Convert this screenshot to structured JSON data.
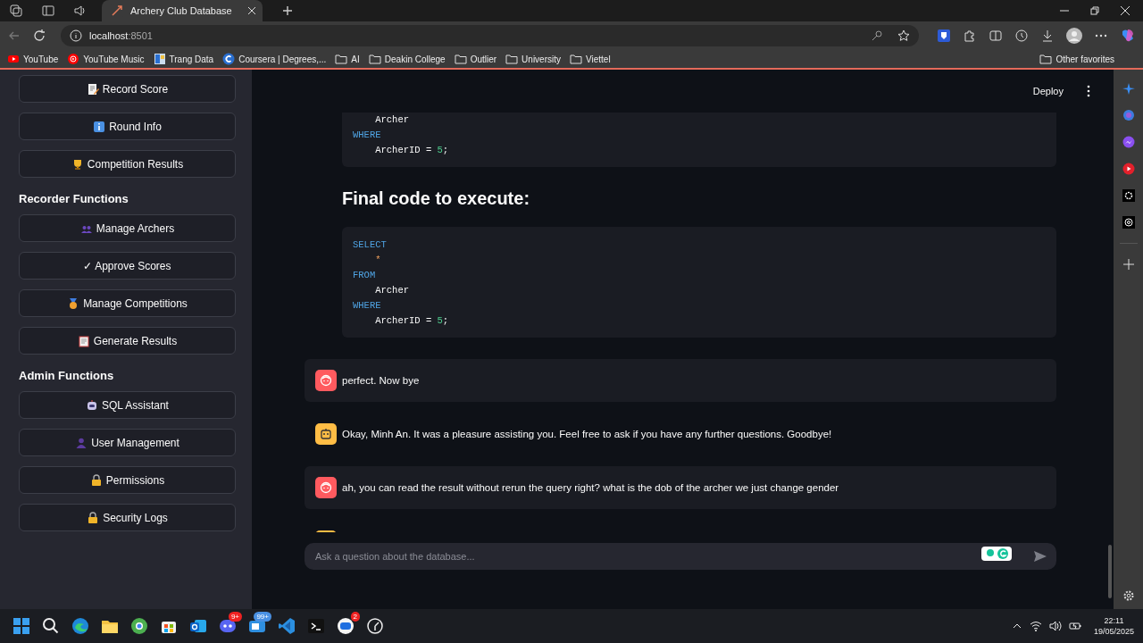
{
  "browser": {
    "tab": {
      "title": "Archery Club Database",
      "selected": true
    },
    "address": {
      "host": "localhost",
      "port": ":8501"
    },
    "bookmarks": [
      {
        "label": "YouTube",
        "kind": "youtube"
      },
      {
        "label": "YouTube Music",
        "kind": "ytmusic"
      },
      {
        "label": "Trang Data",
        "kind": "data"
      },
      {
        "label": "Coursera | Degrees,...",
        "kind": "coursera"
      },
      {
        "label": "AI",
        "kind": "folder"
      },
      {
        "label": "Deakin College",
        "kind": "folder"
      },
      {
        "label": "Outlier",
        "kind": "folder"
      },
      {
        "label": "University",
        "kind": "folder"
      },
      {
        "label": "Viettel",
        "kind": "folder"
      }
    ],
    "other_favorites": "Other favorites"
  },
  "sidebar": {
    "groups": [
      {
        "buttons": [
          {
            "label": "Record Score",
            "kind": "memo"
          },
          {
            "label": "Round Info",
            "kind": "info"
          },
          {
            "label": "Competition Results",
            "kind": "trophy"
          }
        ]
      },
      {
        "heading": "Recorder Functions",
        "buttons": [
          {
            "label": "Manage Archers",
            "kind": "people"
          },
          {
            "label": "✓ Approve Scores",
            "kind": "plain"
          },
          {
            "label": "Manage Competitions",
            "kind": "medal"
          },
          {
            "label": "Generate Results",
            "kind": "clipboard"
          }
        ]
      },
      {
        "heading": "Admin Functions",
        "buttons": [
          {
            "label": "SQL Assistant",
            "kind": "robot"
          },
          {
            "label": "User Management",
            "kind": "person"
          },
          {
            "label": "Permissions",
            "kind": "lockkey"
          },
          {
            "label": "Security Logs",
            "kind": "lock"
          }
        ]
      }
    ]
  },
  "header": {
    "deploy": "Deploy"
  },
  "code_block_top": [
    [
      {
        "text": "    Archer",
        "kind": "plain"
      }
    ],
    [
      {
        "text": "WHERE",
        "kind": "keyword"
      }
    ],
    [
      {
        "text": "    ArcherID = ",
        "kind": "plain"
      },
      {
        "text": "5",
        "kind": "number"
      },
      {
        "text": ";",
        "kind": "plain"
      }
    ]
  ],
  "heading": "Final code to execute:",
  "code_block": [
    [
      {
        "text": "SELECT",
        "kind": "keyword"
      }
    ],
    [
      {
        "text": "    *",
        "kind": "operator"
      }
    ],
    [
      {
        "text": "FROM",
        "kind": "keyword"
      }
    ],
    [
      {
        "text": "    Archer",
        "kind": "plain"
      }
    ],
    [
      {
        "text": "WHERE",
        "kind": "keyword"
      }
    ],
    [
      {
        "text": "    ArcherID = ",
        "kind": "plain"
      },
      {
        "text": "5",
        "kind": "number"
      },
      {
        "text": ";",
        "kind": "plain"
      }
    ]
  ],
  "messages": [
    {
      "kind": "user",
      "text": "perfect. Now bye"
    },
    {
      "kind": "assistant",
      "text": "Okay, Minh An. It was a pleasure assisting you. Feel free to ask if you have any further questions. Goodbye!"
    },
    {
      "kind": "user",
      "text": "ah, you can read the result without rerun the query right? what is the dob of the archer we just change gender"
    },
    {
      "kind": "assistant"
    }
  ],
  "chat_input": {
    "placeholder": "Ask a question about the database..."
  },
  "taskbar": {
    "apps": [
      {
        "kind": "start"
      },
      {
        "kind": "search"
      },
      {
        "kind": "edge"
      },
      {
        "kind": "files"
      },
      {
        "kind": "chrome"
      },
      {
        "kind": "store"
      },
      {
        "kind": "outlook"
      },
      {
        "kind": "discord",
        "badge": "9+"
      },
      {
        "kind": "teams",
        "badge": "99+"
      },
      {
        "kind": "vscode"
      },
      {
        "kind": "terminal"
      },
      {
        "kind": "zalo",
        "badge": "2"
      },
      {
        "kind": "misc"
      }
    ],
    "time": "22:11",
    "date": "19/05/2025"
  }
}
